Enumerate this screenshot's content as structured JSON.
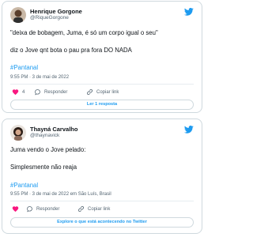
{
  "tweets": [
    {
      "name": "Henrique Gorgone",
      "handle": "@RiqueGorgone",
      "lines": [
        "\"deixa de bobagem, Juma, é só um corpo igual o seu\"",
        "diz o Jove qnt bota o pau pra fora DO NADA"
      ],
      "hashtag": "#Pantanal",
      "timestamp": "9:55 PM · 3 de mai de 2022",
      "like_count": "4",
      "reply_label": "Responder",
      "copy_label": "Copiar link",
      "button_label": "Ler 1 resposta"
    },
    {
      "name": "Thayná Carvalho",
      "handle": "@thaynavick",
      "lines": [
        "Juma vendo o Jove pelado:",
        "Simplesmente não reaja"
      ],
      "hashtag": "#Pantanal",
      "timestamp": "9:55 PM · 3 de mai de 2022 em São Luís, Brasil",
      "like_count": "",
      "reply_label": "Responder",
      "copy_label": "Copiar link",
      "button_label": "Explore o que está acontecendo no Twitter"
    }
  ],
  "icons": [
    "twitter-bird-icon",
    "heart-icon",
    "reply-icon",
    "link-icon"
  ],
  "colors": {
    "brand": "#1d9bf0",
    "like": "#f91880",
    "muted": "#536471",
    "border": "#cfd9de"
  }
}
